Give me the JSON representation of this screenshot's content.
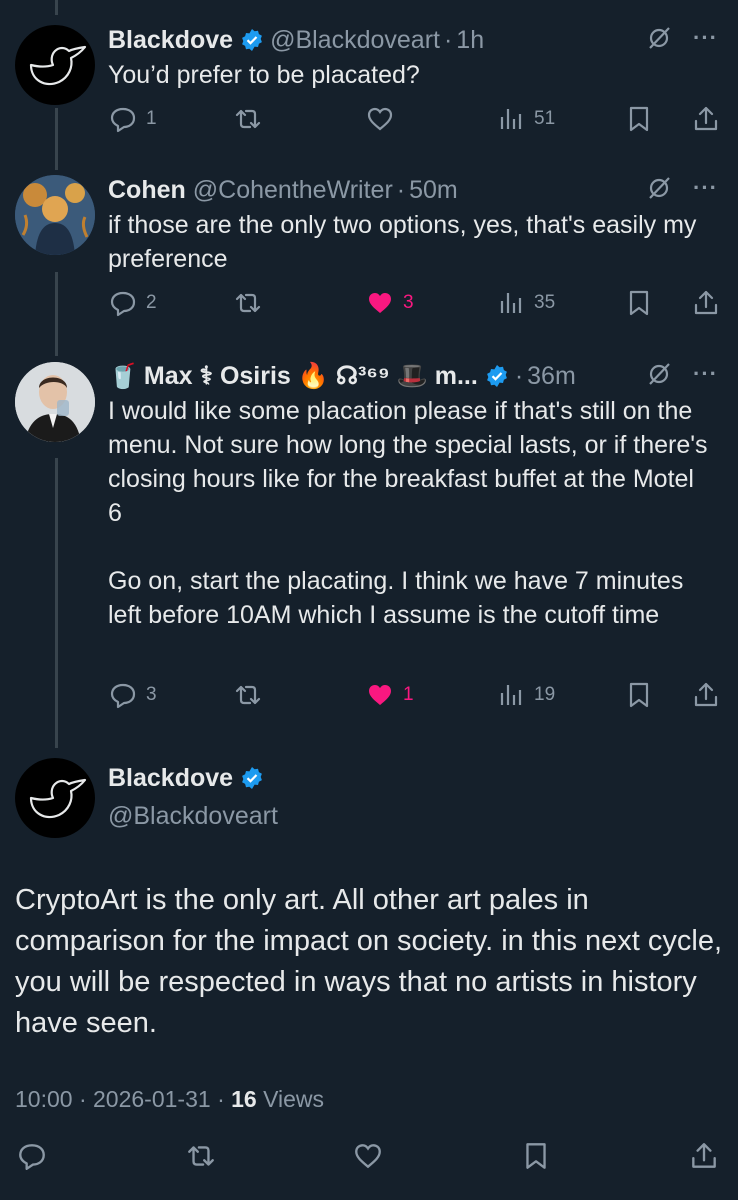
{
  "tweets": [
    {
      "name": "Blackdove",
      "handle": "@Blackdoveart",
      "time": "1h",
      "text": "You’d prefer to be placated?",
      "replies": "1",
      "retweets": "",
      "likes": "",
      "views": "51",
      "liked": false
    },
    {
      "name": "Cohen",
      "handle": "@CohentheWriter",
      "time": "50m",
      "text": "if those are the only two options, yes, that's easily my preference",
      "replies": "2",
      "retweets": "",
      "likes": "3",
      "views": "35",
      "liked": true
    },
    {
      "name_prefix_emoji": "🥤",
      "name": "Max ⚕ Osiris 🔥 ☊³⁶⁹ 🎩  m...",
      "handle": "",
      "time": "36m",
      "text_p1": "I would like some placation please if that's still on the menu. Not sure how long the special lasts, or if there's closing hours like for the breakfast buffet at the Motel 6",
      "text_p2": "Go on, start the placating. I think we have 7 minutes left before 10AM which I assume is the cutoff time",
      "replies": "3",
      "retweets": "",
      "likes": "1",
      "views": "19",
      "liked": true
    }
  ],
  "main": {
    "name": "Blackdove",
    "handle": "@Blackdoveart",
    "text": "CryptoArt is the only art.  All other art pales in comparison for the impact on society.   in this next cycle, you will be respected in ways that no artists in history have seen.",
    "time": "10:00",
    "date": "2026-01-31",
    "views_count": "16",
    "views_label": "Views"
  },
  "colors": {
    "background": "#15202b",
    "verified": "#1d9bf0",
    "like": "#f91880",
    "muted": "#8b98a5"
  }
}
